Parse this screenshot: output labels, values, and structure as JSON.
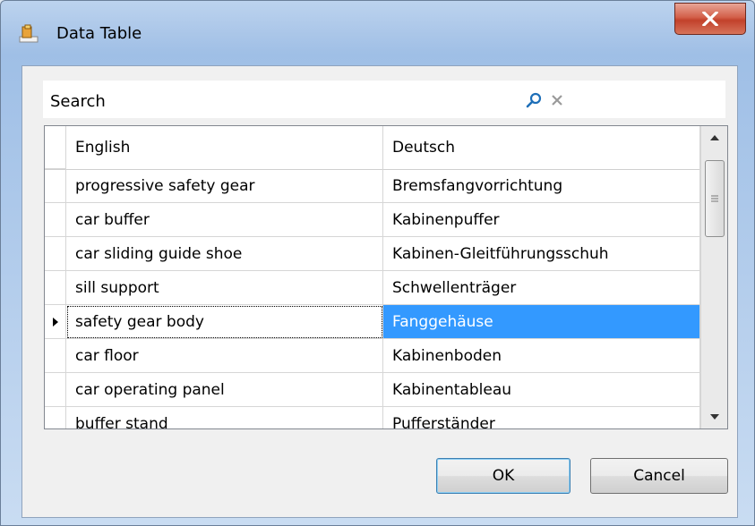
{
  "window": {
    "title": "Data Table"
  },
  "search": {
    "label": "Search",
    "value": "",
    "placeholder": ""
  },
  "table": {
    "columns": [
      "English",
      "Deutsch"
    ],
    "rows": [
      [
        "progressive safety gear",
        "Bremsfangvorrichtung"
      ],
      [
        "car buffer",
        "Kabinenpuffer"
      ],
      [
        "car sliding guide shoe",
        "Kabinen-Gleitführungsschuh"
      ],
      [
        "sill support",
        "Schwellenträger"
      ],
      [
        "safety gear body",
        "Fanggehäuse"
      ],
      [
        "car floor",
        "Kabinenboden"
      ],
      [
        "car operating panel",
        "Kabinentableau"
      ],
      [
        "buffer stand",
        "Pufferständer"
      ]
    ],
    "current_row": 4
  },
  "buttons": {
    "ok": "OK",
    "cancel": "Cancel"
  },
  "colors": {
    "selection": "#3399ff",
    "close": "#c2412b",
    "title_bg": "#a9c5e8"
  }
}
